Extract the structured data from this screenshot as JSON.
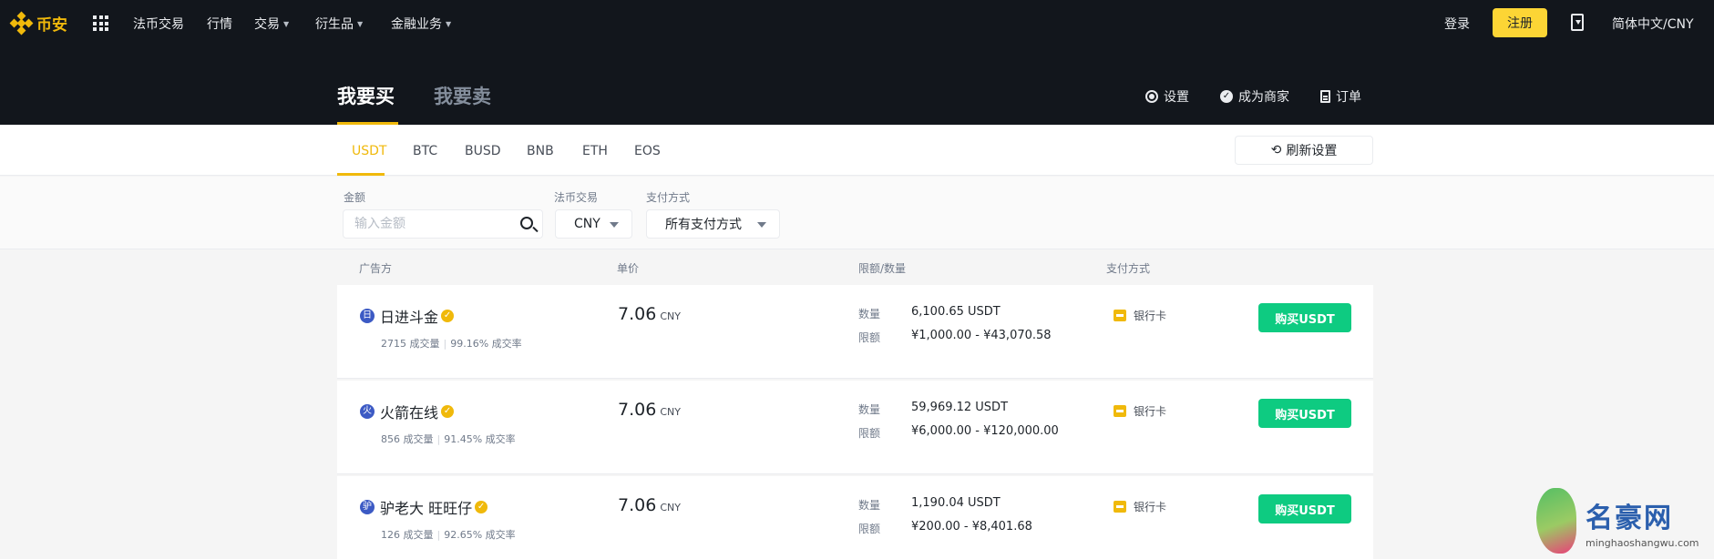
{
  "nav": {
    "brand": "币安",
    "items": [
      {
        "label": "法币交易",
        "caret": false
      },
      {
        "label": "行情",
        "caret": false
      },
      {
        "label": "交易",
        "caret": true
      },
      {
        "label": "衍生品",
        "caret": true
      },
      {
        "label": "金融业务",
        "caret": true
      }
    ],
    "login": "登录",
    "register": "注册",
    "language": "简体中文/CNY"
  },
  "hero": {
    "buy_tab": "我要买",
    "sell_tab": "我要卖",
    "settings": "设置",
    "become_merchant": "成为商家",
    "orders": "订单"
  },
  "crypto_tabs": [
    "USDT",
    "BTC",
    "BUSD",
    "BNB",
    "ETH",
    "EOS"
  ],
  "crypto_active": "USDT",
  "refresh_settings": "刷新设置",
  "filters": {
    "amount_label": "金额",
    "amount_placeholder": "输入金额",
    "fiat_label": "法币交易",
    "fiat_value": "CNY",
    "payment_label": "支付方式",
    "payment_value": "所有支付方式"
  },
  "table": {
    "headers": [
      "广告方",
      "单价",
      "限额/数量",
      "支付方式"
    ],
    "rows": [
      {
        "avatar": "日",
        "merchant": "日进斗金",
        "orders": "2715 成交量",
        "completion": "99.16% 成交率",
        "price": "7.06",
        "currency": "CNY",
        "qty_label": "数量",
        "qty": "6,100.65 USDT",
        "limit_label": "限额",
        "limit": "¥1,000.00 - ¥43,070.58",
        "payment": "银行卡",
        "button": "购买USDT"
      },
      {
        "avatar": "火",
        "merchant": "火箭在线",
        "orders": "856 成交量",
        "completion": "91.45% 成交率",
        "price": "7.06",
        "currency": "CNY",
        "qty_label": "数量",
        "qty": "59,969.12 USDT",
        "limit_label": "限额",
        "limit": "¥6,000.00 - ¥120,000.00",
        "payment": "银行卡",
        "button": "购买USDT"
      },
      {
        "avatar": "驴",
        "merchant": "驴老大 旺旺仔",
        "orders": "126 成交量",
        "completion": "92.65% 成交率",
        "price": "7.06",
        "currency": "CNY",
        "qty_label": "数量",
        "qty": "1,190.04 USDT",
        "limit_label": "限额",
        "limit": "¥200.00 - ¥8,401.68",
        "payment": "银行卡",
        "button": "购买USDT"
      }
    ]
  },
  "watermark": {
    "title": "名豪网",
    "url": "minghaoshangwu.com"
  },
  "colors": {
    "nav_bg": "#12161c",
    "accent": "#f0b90b",
    "buy_green": "#0ecb81"
  }
}
